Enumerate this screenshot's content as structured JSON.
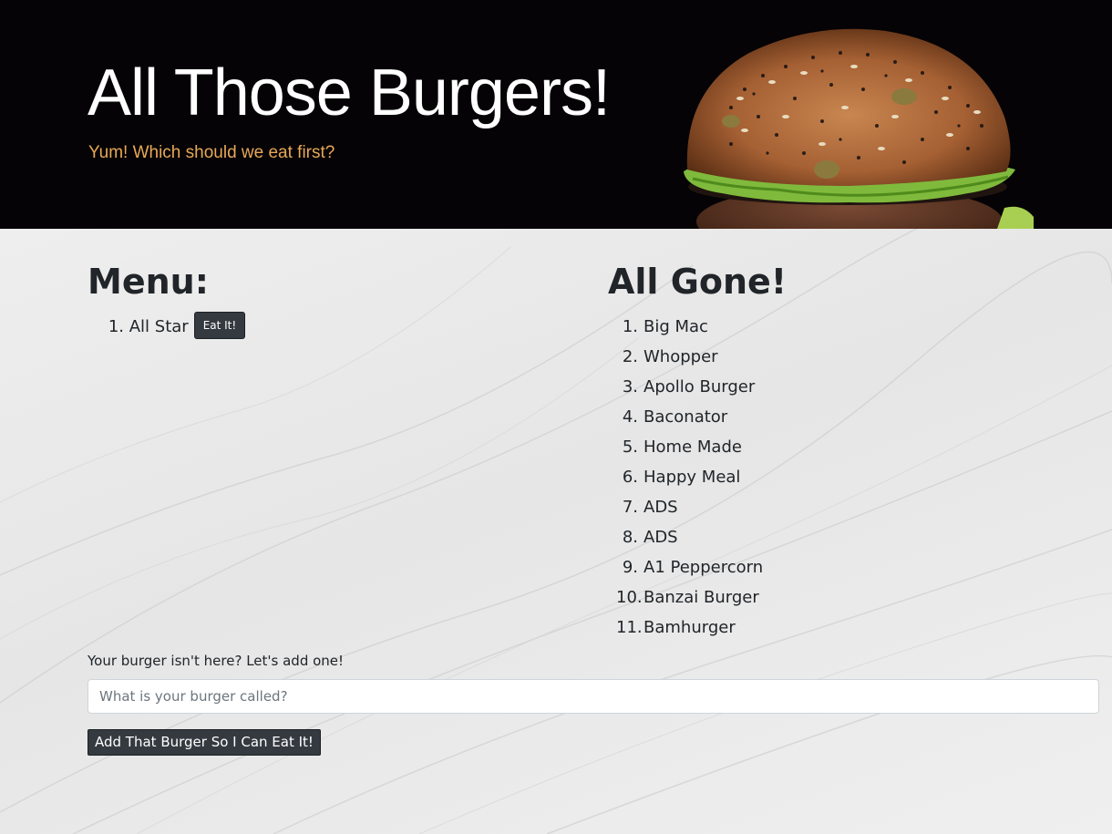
{
  "header": {
    "title": "All Those Burgers!",
    "subtitle": "Yum! Which should we eat first?",
    "image": "burger-photo"
  },
  "menu": {
    "title": "Menu:",
    "items": [
      {
        "number": "1.",
        "name": "All Star",
        "button_label": "Eat It!"
      }
    ]
  },
  "eaten": {
    "title": "All Gone!",
    "items": [
      {
        "number": "1.",
        "name": "Big Mac"
      },
      {
        "number": "2.",
        "name": "Whopper"
      },
      {
        "number": "3.",
        "name": "Apollo Burger"
      },
      {
        "number": "4.",
        "name": "Baconator"
      },
      {
        "number": "5.",
        "name": "Home Made"
      },
      {
        "number": "6.",
        "name": "Happy Meal"
      },
      {
        "number": "7.",
        "name": "ADS"
      },
      {
        "number": "8.",
        "name": "ADS"
      },
      {
        "number": "9.",
        "name": "A1 Peppercorn"
      },
      {
        "number": "10.",
        "name": "Banzai Burger"
      },
      {
        "number": "11.",
        "name": "Bamhurger"
      }
    ]
  },
  "add_form": {
    "label": "Your burger isn't here? Let's add one!",
    "input_value": "",
    "input_placeholder": "What is your burger called?",
    "submit_label": "Add That Burger So I Can Eat It!"
  },
  "colors": {
    "header_bg": "#050305",
    "subtitle": "#e8a857",
    "button_bg": "#343a40"
  }
}
